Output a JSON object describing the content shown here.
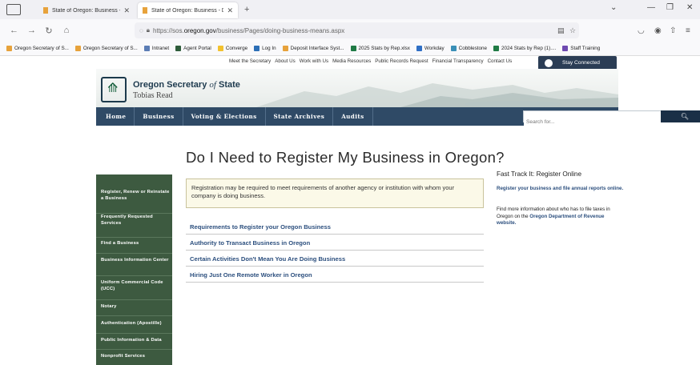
{
  "browser": {
    "tabs": [
      {
        "title": "State of Oregon: Business - Bus",
        "active": false
      },
      {
        "title": "State of Oregon: Business - Do",
        "active": true
      }
    ],
    "url_prefix": "https://sos.",
    "url_domain": "oregon.gov",
    "url_path": "/business/Pages/doing-business-means.aspx",
    "bookmarks": [
      {
        "label": "Oregon Secretary of S...",
        "color": "#e7a23b"
      },
      {
        "label": "Oregon Secretary of S...",
        "color": "#e7a23b"
      },
      {
        "label": "Intranet",
        "color": "#5b7db5"
      },
      {
        "label": "Agent Portal",
        "color": "#2e5c3a"
      },
      {
        "label": "Converge",
        "color": "#f2c12e"
      },
      {
        "label": "Log In",
        "color": "#2c6fb6"
      },
      {
        "label": "Deposit Interface Syst...",
        "color": "#e7a23b"
      },
      {
        "label": "2025 Stats by Rep.xlsx",
        "color": "#1f7a44"
      },
      {
        "label": "Workday",
        "color": "#2f6fc5"
      },
      {
        "label": "Cobblestone",
        "color": "#3a8fb7"
      },
      {
        "label": "2024 Stats by Rep (1)....",
        "color": "#1f7a44"
      },
      {
        "label": "Staff Training",
        "color": "#6e49b0"
      }
    ]
  },
  "utility_nav": [
    "Meet the Secretary",
    "About Us",
    "Work with Us",
    "Media Resources",
    "Public Records Request",
    "Financial Transparency",
    "Contact Us"
  ],
  "stay_connected": "Stay Connected",
  "logo": {
    "title_main": "Oregon Secretary ",
    "title_of": "of",
    "title_end": " State",
    "subtitle": "Tobias Read"
  },
  "main_nav": [
    "Home",
    "Business",
    "Voting & Elections",
    "State Archives",
    "Audits"
  ],
  "search": {
    "placeholder": "Search for..."
  },
  "page_title": "Do I Need to Register My Business in Oregon?",
  "side_nav": [
    "Register, Renew or Reinstate a Business",
    "Frequently Requested Services",
    "Find a Business",
    "Business Information Center",
    "Uniform Commercial Code (UCC)",
    "Notary",
    "Authentication (Apostille)",
    "Public Information & Data",
    "Nonprofit Services"
  ],
  "notice": "Registration may be required to meet requirements of another agency or institution with whom your company is doing business.",
  "links": [
    "Requirements to Register your Oregon Business",
    "Authority to Transact Business in Oregon",
    "Certain Activities Don't Mean You Are Doing Business",
    "Hiring Just One Remote Worker in Oregon"
  ],
  "fast_track": {
    "title": "Fast Track It: Register Online",
    "link1": "Register your business and file annual reports online.",
    "text2": "Find more information about who has to file taxes in Oregon on the ",
    "link2": "Oregon Department of Revenue website."
  }
}
